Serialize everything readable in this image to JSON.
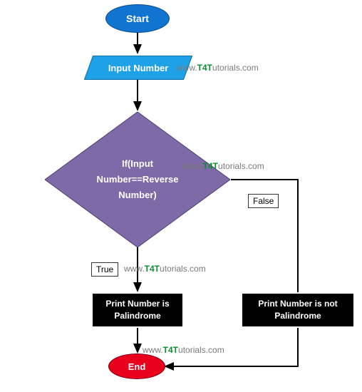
{
  "flowchart": {
    "start": "Start",
    "input": "Input Number",
    "decision": "If(Input Number==Reverse Number)",
    "true_label": "True",
    "false_label": "False",
    "true_outcome": "Print Number is Palindrome",
    "false_outcome": "Print Number is not Palindrome",
    "end": "End",
    "watermark_prefix": "www.",
    "watermark_mid": "T4T",
    "watermark_suffix": "utorials.com",
    "colors": {
      "start_bg": "#1174d0",
      "input_bg": "#1fa1e8",
      "decision_bg": "#7d6aa6",
      "process_bg": "#000000",
      "end_bg": "#e8001c"
    }
  }
}
